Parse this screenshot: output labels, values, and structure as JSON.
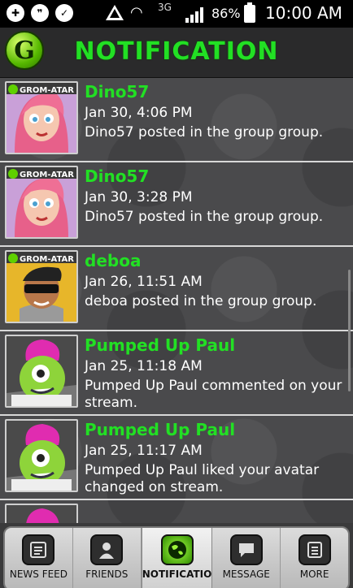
{
  "status_bar": {
    "network": "3G",
    "battery": "86%",
    "time": "10:00 AM",
    "left_icons": [
      "usb-icon",
      "chat-bubble-icon",
      "check-shield-icon"
    ]
  },
  "header": {
    "title": "NOTIFICATION",
    "logo_letter": "G"
  },
  "notifications": [
    {
      "name": "Dino57",
      "time": "Jan 30, 4:06 PM",
      "message": "Dino57 posted in the group group.",
      "avatar": "pink-hair-girl",
      "badge": "GROM-ATAR"
    },
    {
      "name": "Dino57",
      "time": "Jan 30, 3:28 PM",
      "message": "Dino57 posted in the group group.",
      "avatar": "pink-hair-girl",
      "badge": "GROM-ATAR"
    },
    {
      "name": "deboa",
      "time": "Jan 26, 11:51 AM",
      "message": "deboa posted in the group group.",
      "avatar": "sunglasses-boy",
      "badge": "GROM-ATAR"
    },
    {
      "name": "Pumped Up Paul",
      "time": "Jan 25, 11:18 AM",
      "message": "Pumped Up Paul commented on your stream.",
      "avatar": "green-monster"
    },
    {
      "name": "Pumped Up Paul",
      "time": "Jan 25, 11:17 AM",
      "message": "Pumped Up Paul liked your avatar changed on stream.",
      "avatar": "green-monster"
    }
  ],
  "bottom_nav": {
    "items": [
      {
        "label": "NEWS FEED",
        "icon": "news-feed-icon"
      },
      {
        "label": "FRIENDS",
        "icon": "friends-icon"
      },
      {
        "label": "NOTIFICATIO",
        "icon": "globe-icon",
        "active": true
      },
      {
        "label": "MESSAGE",
        "icon": "message-icon"
      },
      {
        "label": "MORE",
        "icon": "more-icon"
      }
    ]
  },
  "colors": {
    "accent": "#22e024",
    "header_bg": "#2a2a2b",
    "list_bg": "#4a4a4c"
  }
}
